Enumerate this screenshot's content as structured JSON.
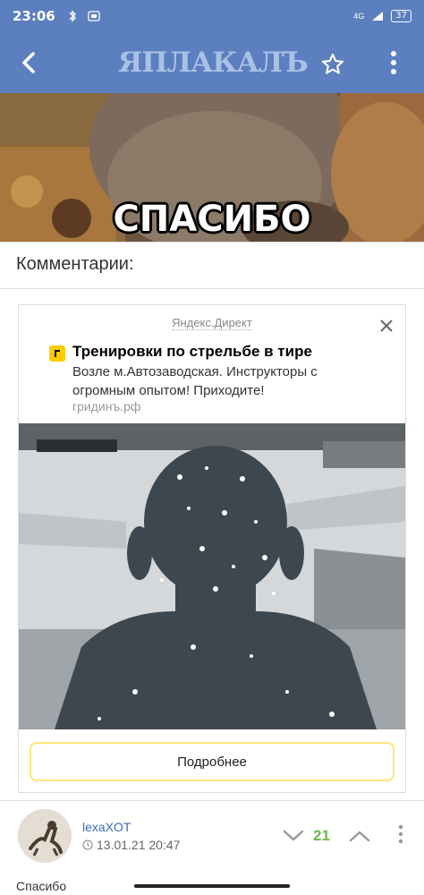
{
  "status_bar": {
    "time": "23:06",
    "network": "4G",
    "battery": "37"
  },
  "app_bar": {
    "logo_text": "ЯПЛАКАЛЪ"
  },
  "hero": {
    "caption": "СПАСИБО"
  },
  "comments": {
    "header": "Комментарии:"
  },
  "ad": {
    "source": "Яндекс.Директ",
    "title": "Тренировки по стрельбе в тире",
    "description": "Возле м.Автозаводская. Инструкторы с огромным опытом! Приходите!",
    "domain": "гридинъ.рф",
    "button_label": "Подробнее",
    "brand_color": "#ffcc00"
  },
  "comment": {
    "username": "lexaXOT",
    "date": "13.01.21 20:47",
    "vote_count": "21",
    "vote_color": "#6cb64f",
    "next_text": "Спасибо"
  },
  "colors": {
    "app_bar": "#5b7fbf",
    "link": "#3a6dbd"
  }
}
